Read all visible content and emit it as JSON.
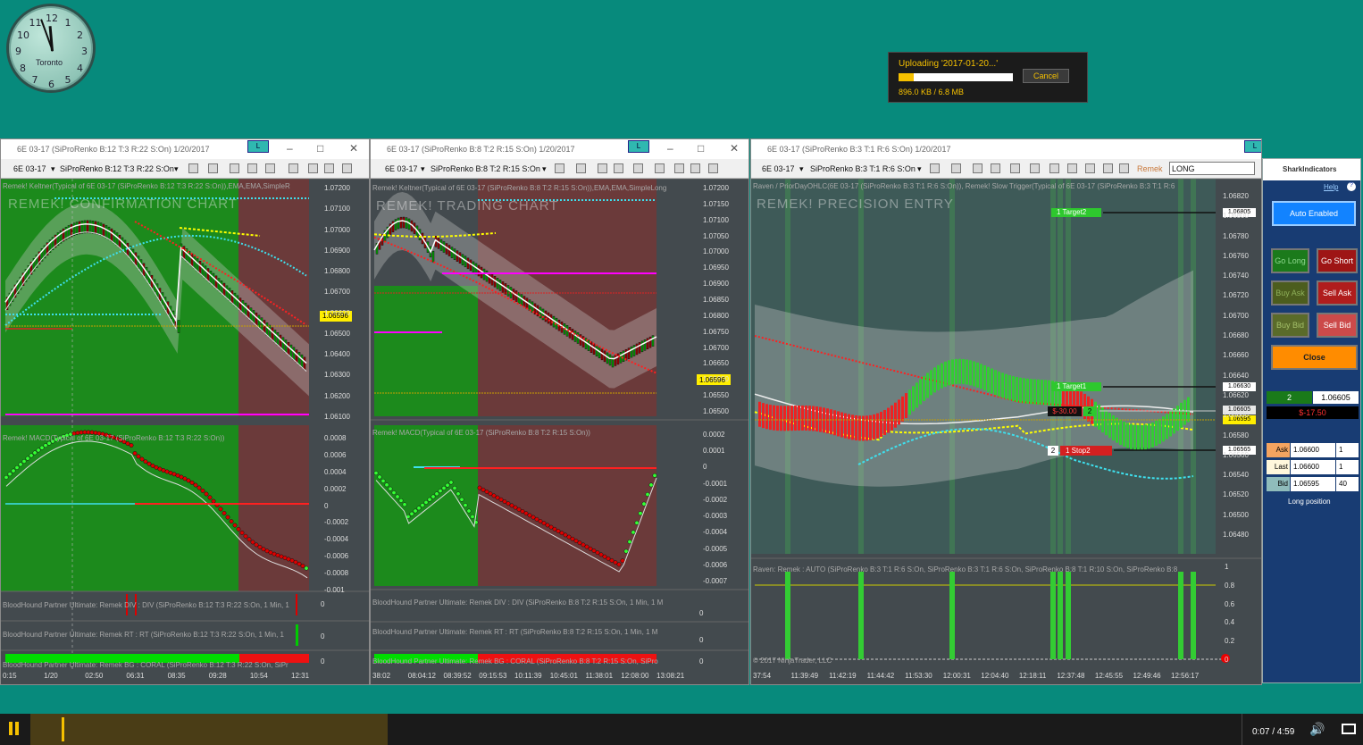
{
  "clock": {
    "city": "Toronto",
    "numerals": [
      "12",
      "1",
      "2",
      "3",
      "4",
      "5",
      "6",
      "7",
      "8",
      "9",
      "10",
      "11"
    ]
  },
  "upload": {
    "title": "Uploading '2017-01-20...'",
    "progress": 0.13,
    "size": "896.0 KB / 6.8 MB",
    "cancel": "Cancel"
  },
  "windows": [
    {
      "title": "6E 03-17 (SiProRenko B:12 T:3 R:22 S:On)  1/20/2017",
      "lbox": "L",
      "instrument": "6E 03-17",
      "series": "SiProRenko B:12 T:3 R:22 S:On",
      "price_label": "Remek! Keltner(Typical of 6E 03-17 (SiProRenko B:12 T:3 R:22 S:On)),EMA,EMA,SimpleR",
      "watermark": "REMEK! CONFIRMATION CHART",
      "price_axis": [
        "1.07200",
        "1.07100",
        "1.07000",
        "1.06900",
        "1.06800",
        "1.06700",
        "1.06600",
        "1.06500",
        "1.06400",
        "1.06300",
        "1.06200",
        "1.06100"
      ],
      "last_price": "1.06596",
      "macd_label": "Remek! MACD(Typical of 6E 03-17 (SiProRenko B:12 T:3 R:22 S:On))",
      "macd_axis": [
        "0.0008",
        "0.0006",
        "0.0004",
        "0.0002",
        "0",
        "-0.0002",
        "-0.0004",
        "-0.0006",
        "-0.0008",
        "-0.001"
      ],
      "div_label": "BloodHound Partner Ultimate: Remek DIV : DIV (SiProRenko B:12 T:3 R:22 S:On, 1 Min, 1",
      "div_axis": [
        "0"
      ],
      "rt_label": "BloodHound Partner Ultimate: Remek RT : RT (SiProRenko B:12 T:3 R:22 S:On, 1 Min, 1",
      "rt_axis": [
        "0"
      ],
      "bg_label": "BloodHound Partner Ultimate: Remek BG : CORAL (SiProRenko B:12 T:3 R:22 S:On, SiPr",
      "bg_axis": [
        "0"
      ],
      "time_axis": [
        "0:15",
        "1/20",
        "02:50",
        "06:31",
        "08:35",
        "09:28",
        "10:54",
        "12:31"
      ]
    },
    {
      "title": "6E 03-17 (SiProRenko B:8 T:2 R:15 S:On)  1/20/2017",
      "lbox": "L",
      "instrument": "6E 03-17",
      "series": "SiProRenko B:8 T:2 R:15 S:On",
      "price_label": "Remek! Keltner(Typical of 6E 03-17 (SiProRenko B:8 T:2 R:15 S:On)),EMA,EMA,SimpleLong",
      "watermark": "REMEK! TRADING CHART",
      "price_axis": [
        "1.07200",
        "1.07150",
        "1.07100",
        "1.07050",
        "1.07000",
        "1.06950",
        "1.06900",
        "1.06850",
        "1.06800",
        "1.06750",
        "1.06700",
        "1.06650",
        "1.06600",
        "1.06550",
        "1.06500"
      ],
      "last_price": "1.06596",
      "macd_label": "Remek! MACD(Typical of 6E 03-17 (SiProRenko B:8 T:2 R:15 S:On))",
      "macd_axis": [
        "0.0002",
        "0.0001",
        "0",
        "-0.0001",
        "-0.0002",
        "-0.0003",
        "-0.0004",
        "-0.0005",
        "-0.0006",
        "-0.0007"
      ],
      "div_label": "BloodHound Partner Ultimate: Remek DIV : DIV (SiProRenko B:8 T:2 R:15 S:On, 1 Min, 1 M",
      "div_axis": [
        "0"
      ],
      "rt_label": "BloodHound Partner Ultimate: Remek RT : RT (SiProRenko B:8 T:2 R:15 S:On, 1 Min, 1 M",
      "rt_axis": [
        "0"
      ],
      "bg_label": "BloodHound Partner Ultimate: Remek BG : CORAL (SiProRenko B:8 T:2 R:15 S:On, SiPro",
      "bg_axis": [
        "0"
      ],
      "time_axis": [
        "38:02",
        "08:04:12",
        "08:39:52",
        "09:15:53",
        "10:11:39",
        "10:45:01",
        "11:38:01",
        "12:08:00",
        "13:08:21"
      ]
    },
    {
      "title": "6E 03-17 (SiProRenko B:3 T:1 R:6 S:On)  1/20/2017",
      "lbox": "L",
      "instrument": "6E 03-17",
      "series": "SiProRenko B:3 T:1 R:6 S:On",
      "remek": "Remek",
      "mode": "LONG",
      "price_label": "Raven / PriorDayOHLC(6E 03-17 (SiProRenko B:3 T:1 R:6 S:On)), Remek! Slow Trigger(Typical of 6E 03-17 (SiProRenko B:3 T:1 R:6",
      "watermark": "REMEK! PRECISION ENTRY",
      "price_axis": [
        "1.06820",
        "1.06800",
        "1.06780",
        "1.06760",
        "1.06740",
        "1.06720",
        "1.06700",
        "1.06680",
        "1.06660",
        "1.06640",
        "1.06620",
        "1.06600",
        "1.06580",
        "1.06560",
        "1.06540",
        "1.06520",
        "1.06500",
        "1.06480"
      ],
      "target2": "1  Target2",
      "target2_price": "1.06805",
      "target1": "1  Target1",
      "target1_price": "1.06630",
      "pnl": "$-30.00",
      "pnl_qty": "2",
      "price_a": "1.06605",
      "price_b": "1.06595",
      "stop_qty": "2",
      "stop": "1  Stop2",
      "stop_price": "1.06565",
      "osc_label": "Raven: Remek : AUTO (SiProRenko B:3 T:1 R:6 S:On, SiProRenko B:3 T:1 R:6 S:On, SiProRenko B:8 T:1 R:10 S:On, SiProRenko B:8",
      "osc_axis": [
        "1",
        "0.8",
        "0.6",
        "0.4",
        "0.2",
        "0"
      ],
      "copyright": "© 2017 NinjaTrader, LLC",
      "time_axis": [
        "37:54",
        "11:39:49",
        "11:42:19",
        "11:44:42",
        "11:53:30",
        "12:00:31",
        "12:04:40",
        "12:18:11",
        "12:37:48",
        "12:45:55",
        "12:49:46",
        "12:56:17"
      ]
    }
  ],
  "side": {
    "logo": "SharkIndicators",
    "help": "Help",
    "auto": "Auto Enabled",
    "go_long": "Go Long",
    "go_short": "Go Short",
    "buy_ask": "Buy Ask",
    "sell_ask": "Sell Ask",
    "buy_bid": "Buy Bid",
    "sell_bid": "Sell Bid",
    "close": "Close",
    "qty": "2",
    "qty_price": "1.06605",
    "pnl": "$-17.50",
    "ask_label": "Ask",
    "ask_price": "1.06600",
    "ask_size": "1",
    "last_label": "Last",
    "last_price": "1.06600",
    "last_size": "1",
    "bid_label": "Bid",
    "bid_price": "1.06595",
    "bid_size": "40",
    "position": "Long position"
  },
  "player": {
    "time": "0:07 / 4:59",
    "progress": 0.023
  }
}
